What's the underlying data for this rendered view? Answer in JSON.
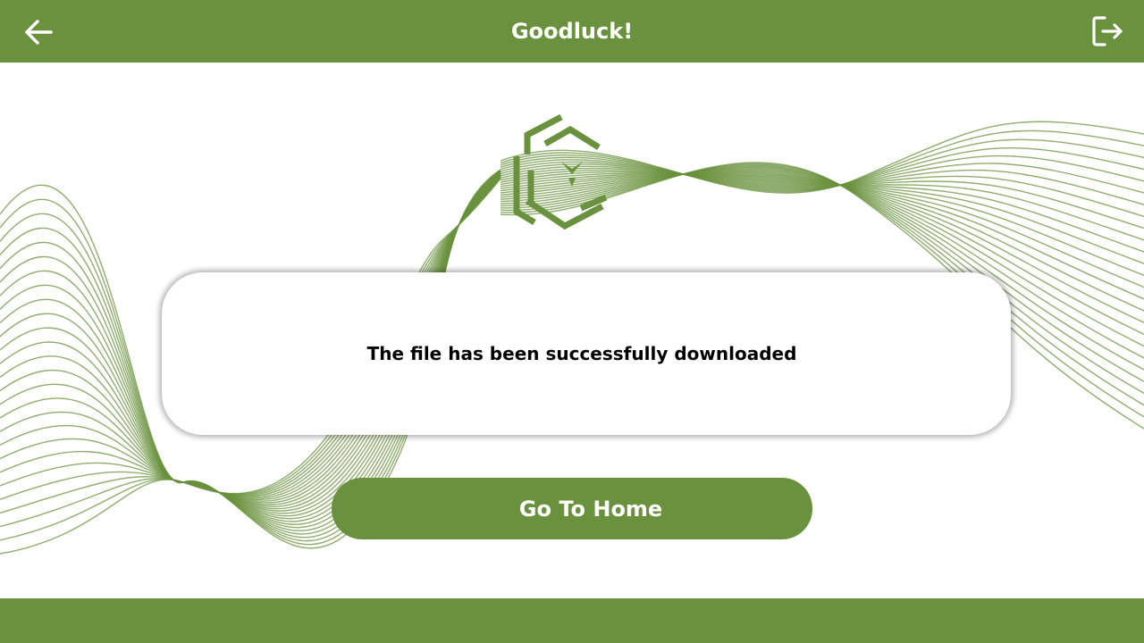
{
  "header": {
    "title": "Goodluck!",
    "back_icon": "arrow-left-icon",
    "logout_icon": "logout-icon"
  },
  "card": {
    "message": "The file has been successfully downloaded"
  },
  "home_button": {
    "label": "Go To Home"
  },
  "colors": {
    "brand": "#6a923e",
    "background": "#ffffff",
    "wave": "#6a923e"
  }
}
